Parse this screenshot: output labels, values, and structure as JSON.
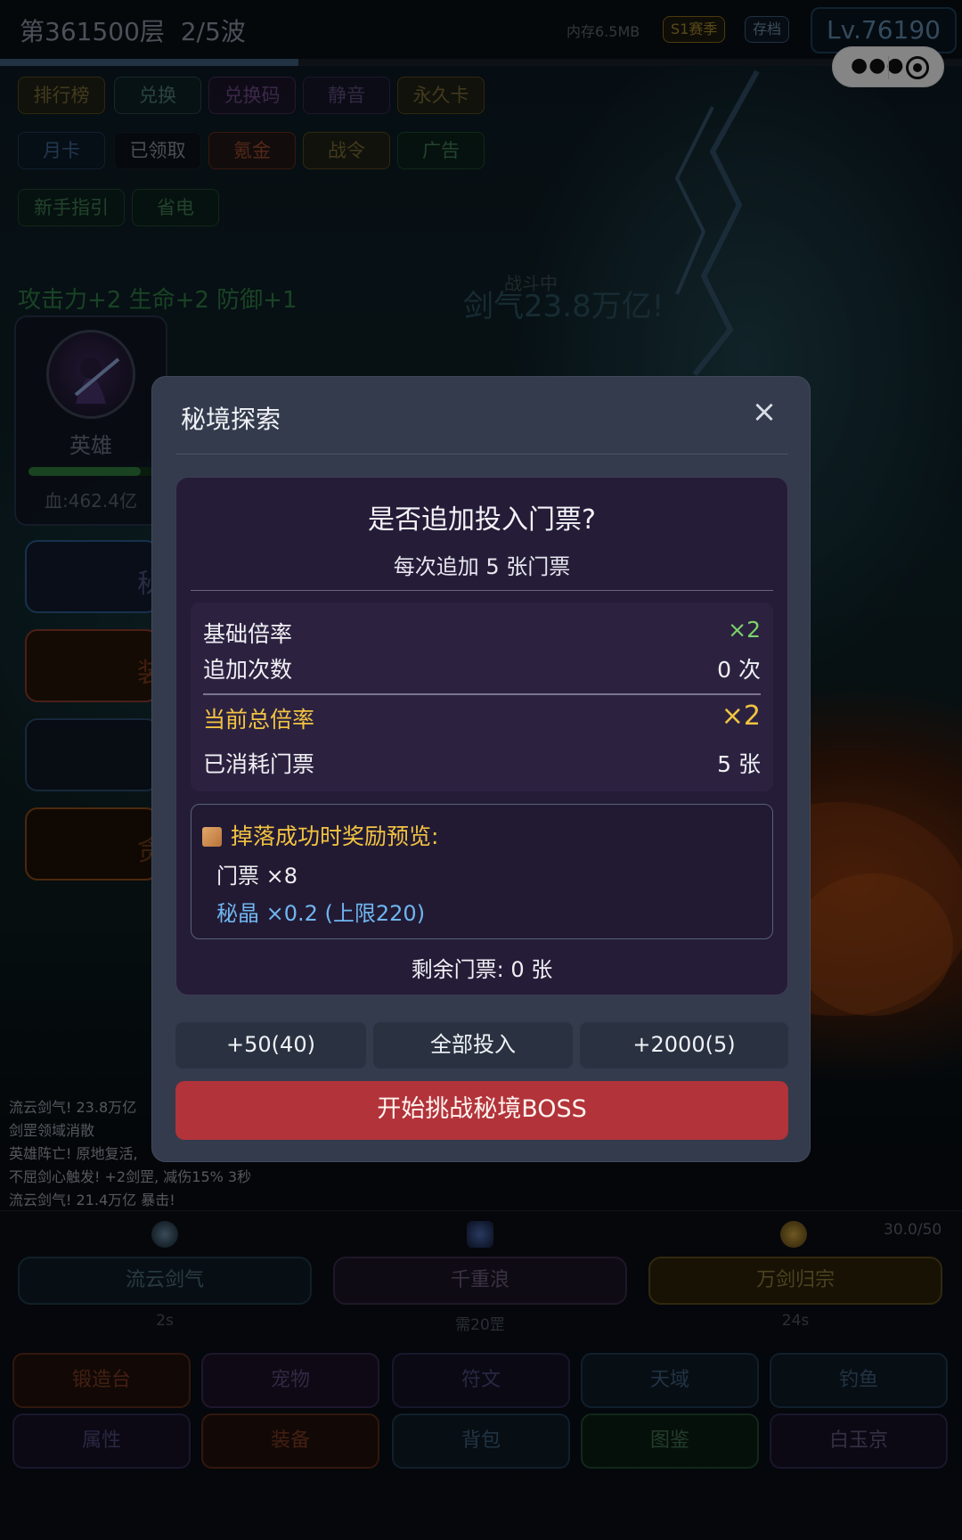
{
  "header": {
    "floor": "第361500层",
    "wave": "2/5波",
    "memory": "内存6.5MB",
    "season": "S1赛季",
    "save": "存档",
    "level": "Lv.76190",
    "progress": 0.31
  },
  "menu_row1": [
    "排行榜",
    "兑换",
    "兑换码",
    "静音",
    "永久卡"
  ],
  "menu_row2": [
    "月卡",
    "已领取",
    "氪金",
    "战令",
    "广告"
  ],
  "menu_row3": [
    "新手指引",
    "省电"
  ],
  "battle": {
    "bonus": "攻击力+2 生命+2 防御+1",
    "status": "战斗中",
    "jianqi": "剑气23.8万亿!",
    "hero_name": "英雄",
    "hero_hp": "血:462.4亿",
    "hp_fraction": 0.9,
    "side_buttons": [
      "秘",
      "装",
      "",
      "贪"
    ]
  },
  "modal": {
    "title": "秘境探索",
    "close": "×",
    "question": "是否追加投入门票?",
    "subtitle": "每次追加 5 张门票",
    "stats": [
      {
        "label": "基础倍率",
        "value": "×2"
      },
      {
        "label": "追加次数",
        "value": "0 次"
      },
      {
        "label": "当前总倍率",
        "value": "×2"
      },
      {
        "label": "已消耗门票",
        "value": "5 张"
      }
    ],
    "reward_title": "掉落成功时奖励预览:",
    "reward_items": [
      "门票 ×8",
      "秘晶 ×0.2 (上限220)"
    ],
    "remaining": "剩余门票: 0 张",
    "btn_add50": "+50(40)",
    "btn_all": "全部投入",
    "btn_add2000": "+2000(5)",
    "btn_challenge": "开始挑战秘境BOSS"
  },
  "log": [
    "流云剑气! 23.8万亿",
    "剑罡领域消散",
    "英雄阵亡! 原地复活,",
    "不屈剑心触发! +2剑罡, 减伤15% 3秒",
    "流云剑气! 21.4万亿 暴击!"
  ],
  "skills": {
    "count": "30.0/50",
    "items": [
      {
        "name": "流云剑气",
        "cd": "2s"
      },
      {
        "name": "千重浪",
        "cd": "需20罡"
      },
      {
        "name": "万剑归宗",
        "cd": "24s"
      }
    ]
  },
  "nav_row1": [
    "锻造台",
    "宠物",
    "符文",
    "天域",
    "钓鱼"
  ],
  "nav_row2": [
    "属性",
    "装备",
    "背包",
    "图鉴",
    "白玉京"
  ],
  "colors": {
    "accent_red": "#b2333a",
    "gold": "#f2c341",
    "green": "#7bd36b",
    "blue": "#6fb6f0"
  }
}
